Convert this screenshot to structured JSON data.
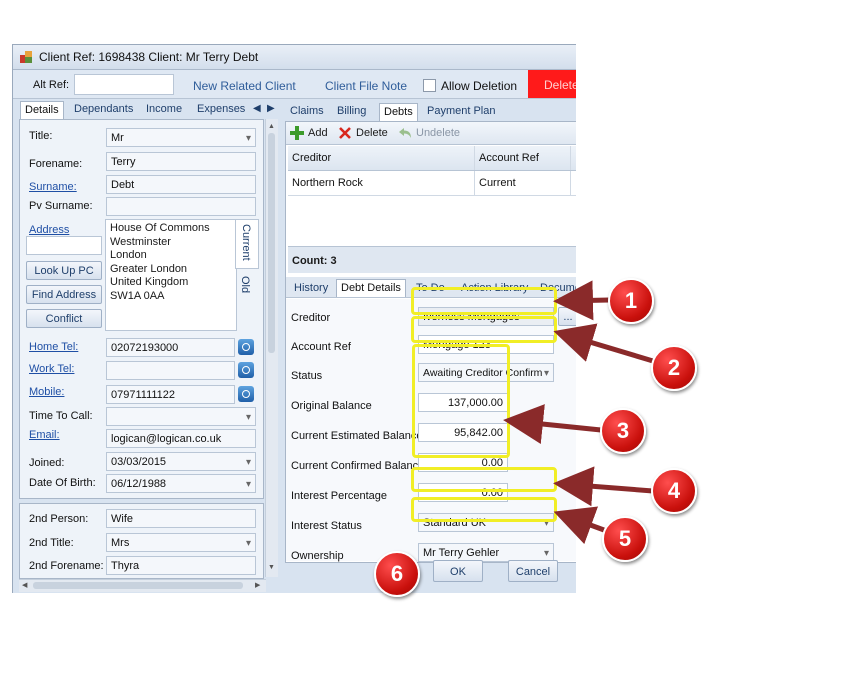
{
  "window": {
    "title": "Client Ref: 1698438 Client: Mr Terry Debt",
    "toolbar": {
      "alt_ref_label": "Alt Ref:",
      "alt_ref_value": "",
      "new_related_client": "New Related Client",
      "client_file_note": "Client File Note",
      "allow_deletion": "Allow Deletion",
      "delete_label": "Delete"
    }
  },
  "left_tabs": [
    "Details",
    "Dependants",
    "Income",
    "Expenses"
  ],
  "details": {
    "title_label": "Title:",
    "title_value": "Mr",
    "forename_label": "Forename:",
    "forename_value": "Terry",
    "surname_label": "Surname:",
    "surname_value": "Debt",
    "pv_surname_label": "Pv Surname:",
    "pv_surname_value": "",
    "address_label": "Address",
    "address_lines": [
      "House Of Commons",
      "Westminster",
      "London",
      "Greater London",
      "United Kingdom",
      "SW1A 0AA"
    ],
    "vtab_current": "Current",
    "vtab_old": "Old",
    "look_up_pc": "Look Up PC",
    "find_address": "Find Address",
    "conflict": "Conflict",
    "home_tel_label": "Home Tel:",
    "home_tel_value": "02072193000",
    "work_tel_label": "Work Tel:",
    "work_tel_value": "",
    "mobile_label": "Mobile:",
    "mobile_value": "07971111122",
    "time_to_call_label": "Time To Call:",
    "time_to_call_value": "",
    "email_label": "Email:",
    "email_value": "logican@logican.co.uk",
    "joined_label": "Joined:",
    "joined_value": "03/03/2015",
    "dob_label": "Date Of Birth:",
    "dob_value": "06/12/1988",
    "second_person_label": "2nd Person:",
    "second_person_value": "Wife",
    "second_title_label": "2nd Title:",
    "second_title_value": "Mrs",
    "second_forename_label": "2nd Forename:",
    "second_forename_value": "Thyra"
  },
  "right_tabs": [
    "Claims",
    "Billing",
    "Debts",
    "Payment Plan"
  ],
  "debt_toolbar": {
    "add": "Add",
    "delete": "Delete",
    "undelete": "Undelete"
  },
  "debt_grid": {
    "columns": [
      "Creditor",
      "Account Ref"
    ],
    "rows": [
      {
        "creditor": "Northern Rock",
        "account_ref": "Current"
      }
    ],
    "count": "Count: 3"
  },
  "debt_sub_tabs": [
    "History",
    "Debt Details",
    "To Do",
    "Action Library",
    "Docume"
  ],
  "debt_details": {
    "creditor_label": "Creditor",
    "creditor_value": "Iverness Mortgages",
    "creditor_btn": "...",
    "account_ref_label": "Account Ref",
    "account_ref_value": "Mortgage 123",
    "status_label": "Status",
    "status_value": "Awaiting Creditor Confirm",
    "original_balance_label": "Original Balance",
    "original_balance_value": "137,000.00",
    "current_est_label": "Current Estimated Balance",
    "current_est_value": "95,842.00",
    "current_conf_label": "Current Confirmed Balance",
    "current_conf_value": "0.00",
    "interest_pct_label": "Interest Percentage",
    "interest_pct_value": "0.00",
    "interest_status_label": "Interest Status",
    "interest_status_value": "Standard UK",
    "ownership_label": "Ownership",
    "ownership_value": "Mr Terry Gehler"
  },
  "dialog_buttons": {
    "ok": "OK",
    "cancel": "Cancel"
  },
  "callouts": [
    "1",
    "2",
    "3",
    "4",
    "5",
    "6"
  ],
  "colors": {
    "callout_red": "#d2120e",
    "highlight_yellow": "#f1ee26",
    "delete_red": "#ff1a1a",
    "arrow": "#8a2a2a"
  }
}
